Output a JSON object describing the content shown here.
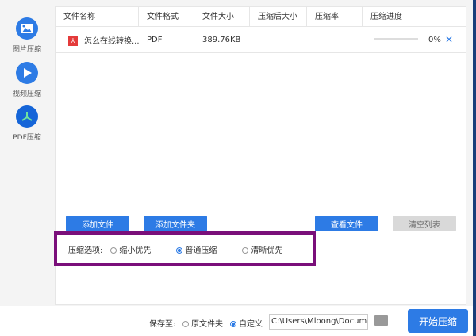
{
  "sidebar": {
    "items": [
      {
        "label": "图片压缩",
        "icon": "image-icon"
      },
      {
        "label": "视频压缩",
        "icon": "play-icon"
      },
      {
        "label": "PDF压缩",
        "icon": "pdf-icon"
      }
    ]
  },
  "table": {
    "headers": [
      "文件名称",
      "文件格式",
      "文件大小",
      "压缩后大小",
      "压缩率",
      "压缩进度"
    ],
    "rows": [
      {
        "name": "怎么在线转换...",
        "format": "PDF",
        "size": "389.76KB",
        "compressed": "",
        "rate": "",
        "progress": 0,
        "progress_text": "0%"
      }
    ]
  },
  "buttons": {
    "add_file": "添加文件",
    "add_folder": "添加文件夹",
    "view_files": "查看文件",
    "clear_list": "清空列表",
    "start": "开始压缩"
  },
  "options": {
    "label": "压缩选项:",
    "items": [
      "缩小优先",
      "普通压缩",
      "清晰优先"
    ],
    "selected": "普通压缩"
  },
  "save": {
    "label": "保存至:",
    "original": "原文件夹",
    "custom": "自定义",
    "selected": "自定义",
    "path": "C:\\Users\\Mloong\\Documents"
  },
  "colors": {
    "accent": "#2d7be5",
    "highlight": "#7a0f7a"
  }
}
